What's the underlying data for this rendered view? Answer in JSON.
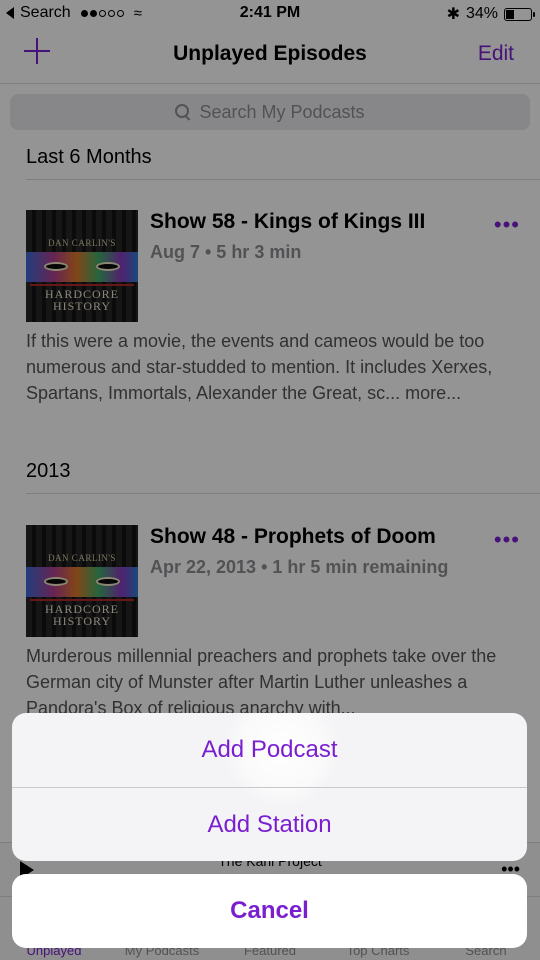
{
  "status_bar": {
    "back_label": "Search",
    "signal": [
      true,
      true,
      false,
      false,
      false
    ],
    "time": "2:41 PM",
    "battery_text": "34%",
    "battery_level": 0.34
  },
  "nav": {
    "add_icon": "plus-icon",
    "title": "Unplayed Episodes",
    "edit_label": "Edit"
  },
  "search": {
    "placeholder": "Search My Podcasts",
    "icon": "search-icon"
  },
  "sections": [
    {
      "header": "Last 6 Months",
      "episode": {
        "artwork_top": "DAN CARLIN'S",
        "artwork_line1": "HARDCORE",
        "artwork_line2": "HISTORY",
        "title": "Show 58 - Kings of Kings III",
        "meta": "Aug 7 • 5 hr 3 min",
        "more_icon": "ellipsis-icon",
        "description": "If this were a movie, the events and cameos would be too numerous and star-studded to mention. It includes Xerxes, Spartans, Immortals, Alexander the Great, sc... more..."
      }
    },
    {
      "header": "2013",
      "episode": {
        "artwork_top": "DAN CARLIN'S",
        "artwork_line1": "HARDCORE",
        "artwork_line2": "HISTORY",
        "title": "Show 48 - Prophets of Doom",
        "meta": "Apr 22, 2013 • 1 hr 5 min remaining",
        "more_icon": "ellipsis-icon",
        "description": "Murderous millennial preachers and prophets take over the German city of Munster after Martin Luther unleashes a Pandora's Box of religious anarchy with..."
      }
    }
  ],
  "now_playing": {
    "title": "The Kahl Project"
  },
  "tabs": [
    {
      "label": "Unplayed"
    },
    {
      "label": "My Podcasts"
    },
    {
      "label": "Featured"
    },
    {
      "label": "Top Charts"
    },
    {
      "label": "Search"
    }
  ],
  "action_sheet": {
    "add_podcast": "Add Podcast",
    "add_station": "Add Station",
    "cancel": "Cancel"
  },
  "colors": {
    "accent": "#7a1fd0",
    "secondary_text": "#8e8e93"
  }
}
